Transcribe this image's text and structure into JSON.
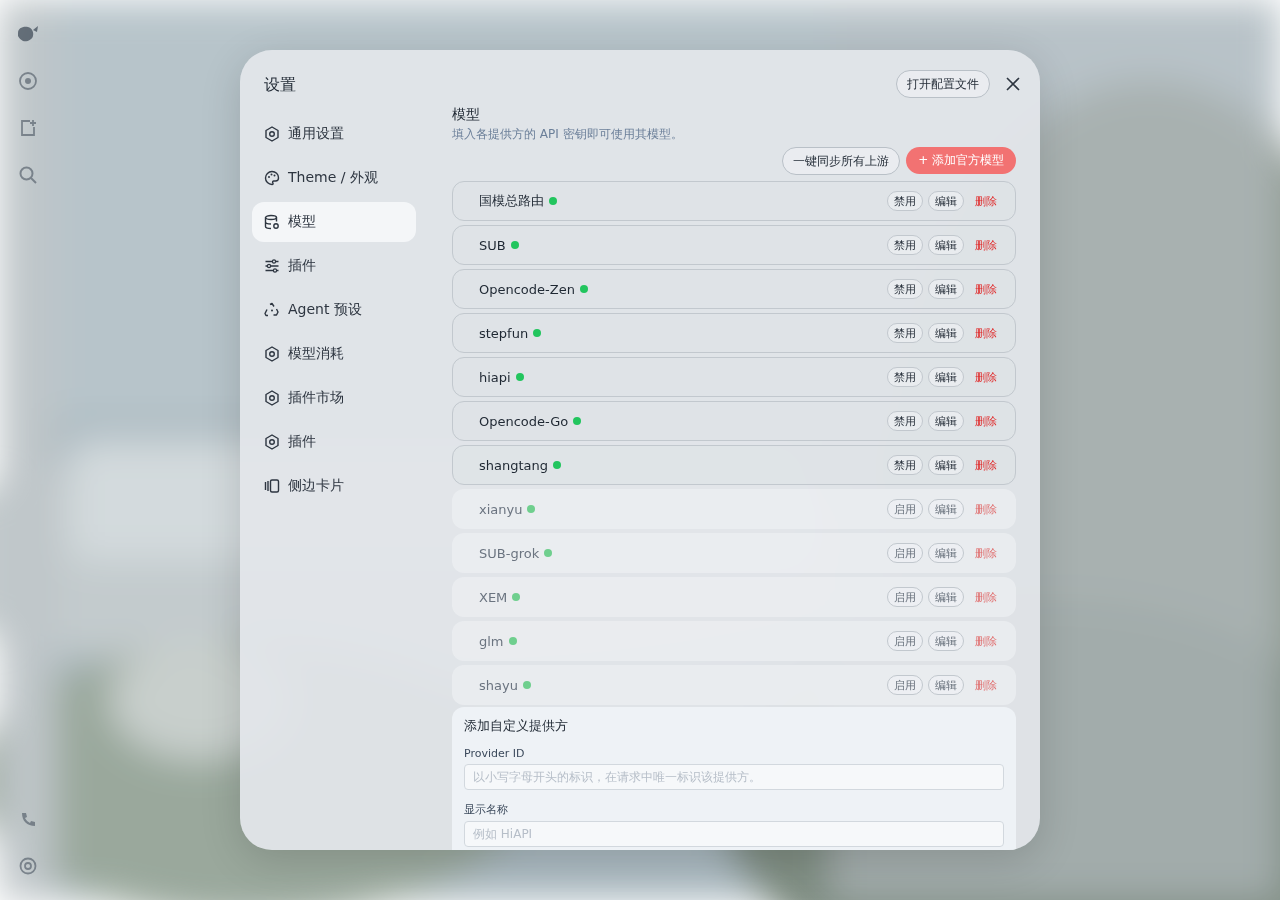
{
  "settings": {
    "title": "设置",
    "open_config_label": "打开配置文件"
  },
  "nav": [
    {
      "label": "通用设置",
      "kind": "gear",
      "selected": false
    },
    {
      "label": "Theme / 外观",
      "kind": "palette",
      "selected": false
    },
    {
      "label": "模型",
      "kind": "database",
      "selected": true
    },
    {
      "label": "插件",
      "kind": "sliders",
      "selected": false
    },
    {
      "label": "Agent 预设",
      "kind": "recycle",
      "selected": false
    },
    {
      "label": "模型消耗",
      "kind": "gear",
      "selected": false
    },
    {
      "label": "插件市场",
      "kind": "gear",
      "selected": false
    },
    {
      "label": "插件",
      "kind": "gear",
      "selected": false
    },
    {
      "label": "侧边卡片",
      "kind": "cards",
      "selected": false
    }
  ],
  "section": {
    "title": "模型",
    "subtitle": "填入各提供方的 API 密钥即可使用其模型。",
    "sync_label": "一键同步所有上游",
    "add_label": "+ 添加官方模型"
  },
  "providers": [
    {
      "name": "国模总路由",
      "enabled": true,
      "toggle_label": "禁用",
      "edit_label": "编辑",
      "delete_label": "删除"
    },
    {
      "name": "SUB",
      "enabled": true,
      "toggle_label": "禁用",
      "edit_label": "编辑",
      "delete_label": "删除"
    },
    {
      "name": "Opencode-Zen",
      "enabled": true,
      "toggle_label": "禁用",
      "edit_label": "编辑",
      "delete_label": "删除"
    },
    {
      "name": "stepfun",
      "enabled": true,
      "toggle_label": "禁用",
      "edit_label": "编辑",
      "delete_label": "删除"
    },
    {
      "name": "hiapi",
      "enabled": true,
      "toggle_label": "禁用",
      "edit_label": "编辑",
      "delete_label": "删除"
    },
    {
      "name": "Opencode-Go",
      "enabled": true,
      "toggle_label": "禁用",
      "edit_label": "编辑",
      "delete_label": "删除"
    },
    {
      "name": "shangtang",
      "enabled": true,
      "toggle_label": "禁用",
      "edit_label": "编辑",
      "delete_label": "删除"
    },
    {
      "name": "xianyu",
      "enabled": false,
      "toggle_label": "启用",
      "edit_label": "编辑",
      "delete_label": "删除"
    },
    {
      "name": "SUB-grok",
      "enabled": false,
      "toggle_label": "启用",
      "edit_label": "编辑",
      "delete_label": "删除"
    },
    {
      "name": "XEM",
      "enabled": false,
      "toggle_label": "启用",
      "edit_label": "编辑",
      "delete_label": "删除"
    },
    {
      "name": "glm",
      "enabled": false,
      "toggle_label": "启用",
      "edit_label": "编辑",
      "delete_label": "删除"
    },
    {
      "name": "shayu",
      "enabled": false,
      "toggle_label": "启用",
      "edit_label": "编辑",
      "delete_label": "删除"
    }
  ],
  "custom_provider": {
    "title": "添加自定义提供方",
    "fields": [
      {
        "label": "Provider ID",
        "placeholder": "以小写字母开头的标识，在请求中唯一标识该提供方。"
      },
      {
        "label": "显示名称",
        "placeholder": "例如 HiAPI"
      }
    ]
  }
}
